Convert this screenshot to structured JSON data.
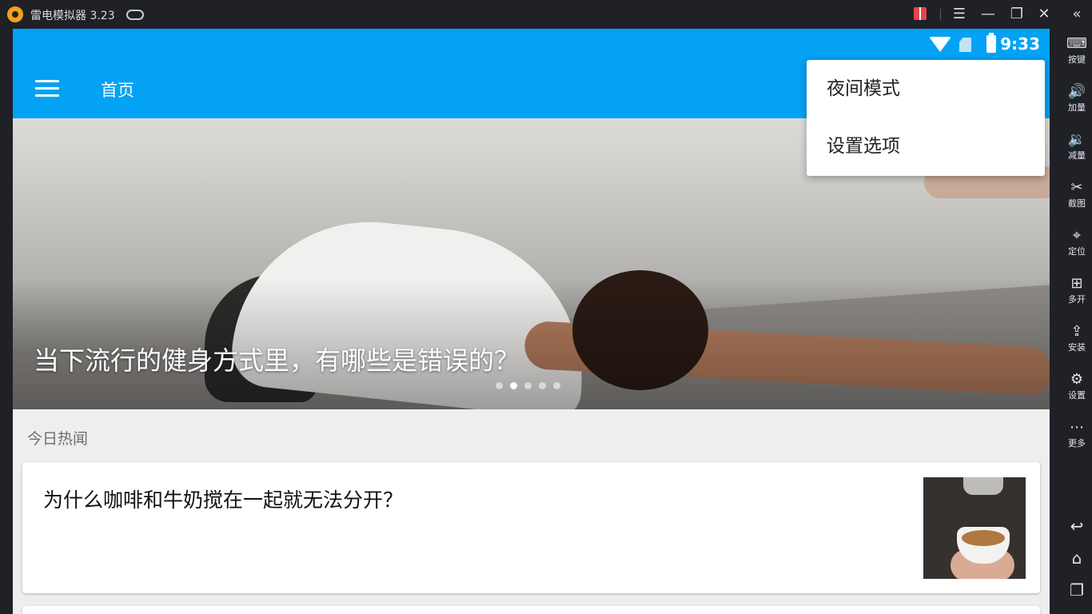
{
  "titlebar": {
    "app_name": "雷电模拟器",
    "version": "3.23",
    "icons": [
      "gamepad-icon",
      "gift-icon",
      "menu-icon",
      "minimize-icon",
      "restore-icon",
      "close-icon",
      "collapse-icon"
    ]
  },
  "status_bar": {
    "time": "9:33",
    "icons": [
      "wifi-icon",
      "no-sim-icon",
      "battery-charging-icon"
    ]
  },
  "app_bar": {
    "title": "首页"
  },
  "menu": {
    "items": [
      {
        "label": "夜间模式"
      },
      {
        "label": "设置选项"
      }
    ]
  },
  "banner": {
    "title": "当下流行的健身方式里，有哪些是错误的？",
    "slides_total": 5,
    "active_slide": 2
  },
  "section": {
    "title": "今日热闻"
  },
  "news": [
    {
      "title": "为什么咖啡和牛奶搅在一起就无法分开？"
    }
  ],
  "sidebar": {
    "items": [
      {
        "label": "按键",
        "icon": "keyboard-icon",
        "glyph": "⌨"
      },
      {
        "label": "加量",
        "icon": "volume-up-icon",
        "glyph": "🔊"
      },
      {
        "label": "减量",
        "icon": "volume-down-icon",
        "glyph": "🔉"
      },
      {
        "label": "截图",
        "icon": "scissors-icon",
        "glyph": "✂"
      },
      {
        "label": "定位",
        "icon": "location-icon",
        "glyph": "⌖"
      },
      {
        "label": "多开",
        "icon": "multi-instance-icon",
        "glyph": "⊞"
      },
      {
        "label": "安装",
        "icon": "apk-install-icon",
        "glyph": "⇪"
      },
      {
        "label": "设置",
        "icon": "gear-icon",
        "glyph": "⚙"
      },
      {
        "label": "更多",
        "icon": "more-icon",
        "glyph": "⋯"
      }
    ],
    "nav": [
      {
        "icon": "back-icon",
        "glyph": "↩"
      },
      {
        "icon": "home-icon",
        "glyph": "⌂"
      },
      {
        "icon": "recents-icon",
        "glyph": "❐"
      }
    ]
  }
}
